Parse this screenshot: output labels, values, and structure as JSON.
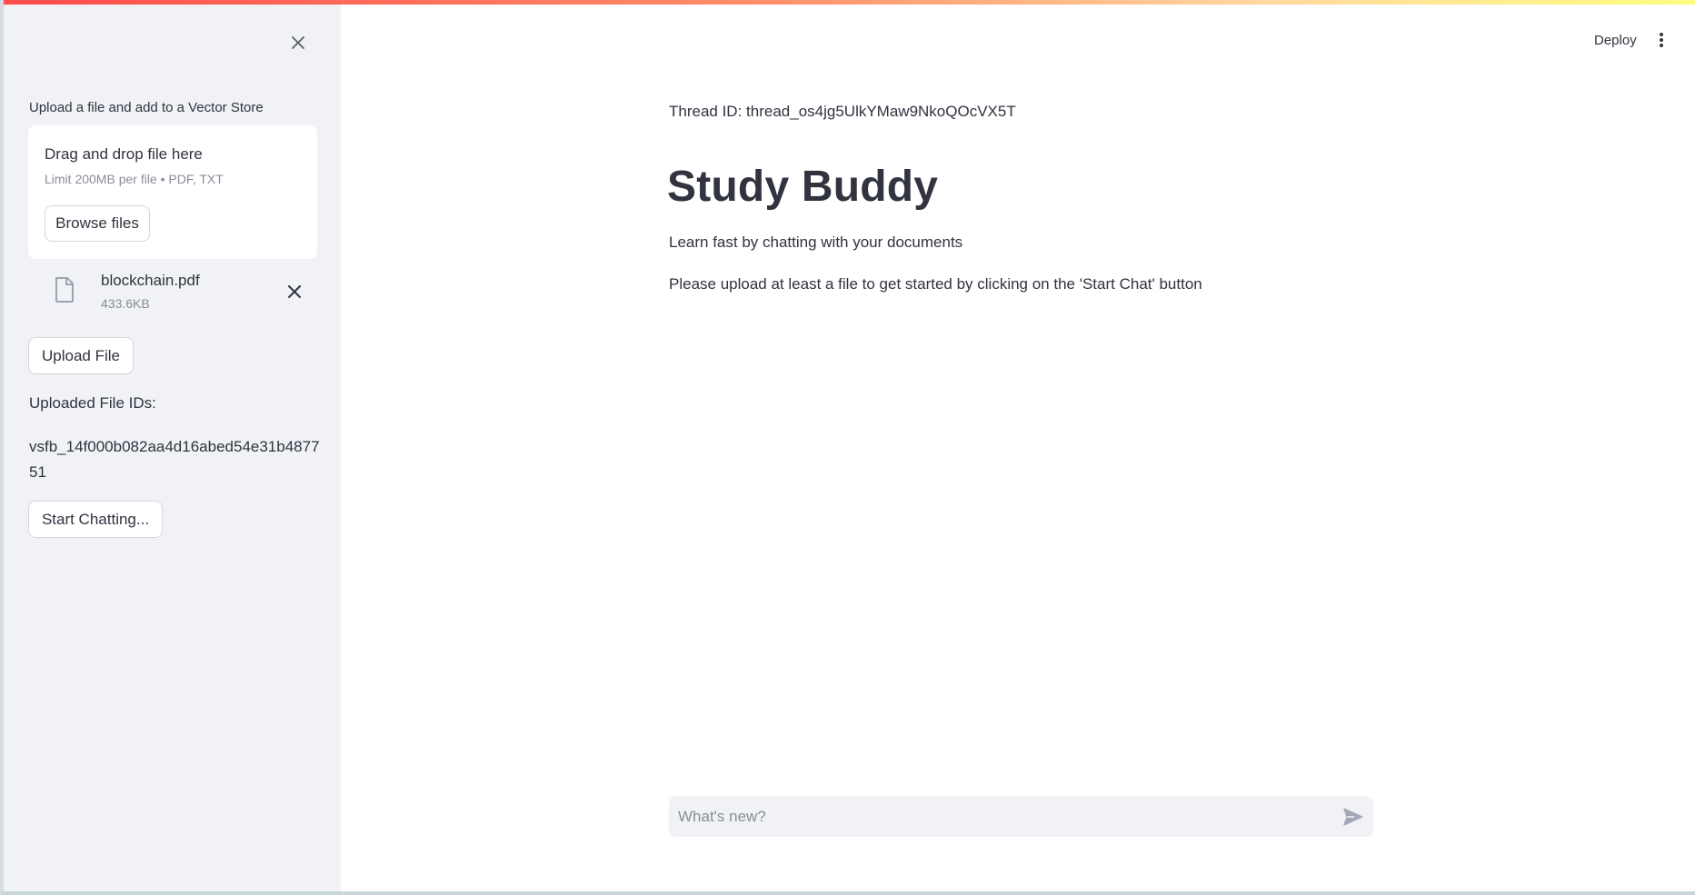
{
  "colors": {
    "sidebar_bg": "#f0f2f6",
    "text": "#31333f",
    "muted": "#8a8d98",
    "accent": "#ff4b4b"
  },
  "header": {
    "deploy_label": "Deploy",
    "menu_icon": "vertical-ellipsis-icon"
  },
  "sidebar": {
    "close_icon": "close-icon",
    "uploader_label": "Upload a file and add to a Vector Store",
    "dropzone": {
      "title": "Drag and drop file here",
      "limit_text": "Limit 200MB per file • PDF, TXT",
      "browse_label": "Browse files"
    },
    "uploaded_file": {
      "name": "blockchain.pdf",
      "size": "433.6KB",
      "icon": "file-icon",
      "remove_icon": "close-icon"
    },
    "upload_button_label": "Upload File",
    "uploaded_ids_label": "Uploaded File IDs:",
    "uploaded_ids_value": "vsfb_14f000b082aa4d16abed54e31b487751",
    "start_chat_label": "Start Chatting..."
  },
  "main": {
    "thread_id": "Thread ID: thread_os4jg5UlkYMaw9NkoQOcVX5T",
    "title": "Study Buddy",
    "subtitle": "Learn fast by chatting with your documents",
    "instructions": "Please upload at least a file to get started by clicking on the 'Start Chat' button"
  },
  "chat": {
    "placeholder": "What's new?",
    "send_icon": "send-icon"
  }
}
